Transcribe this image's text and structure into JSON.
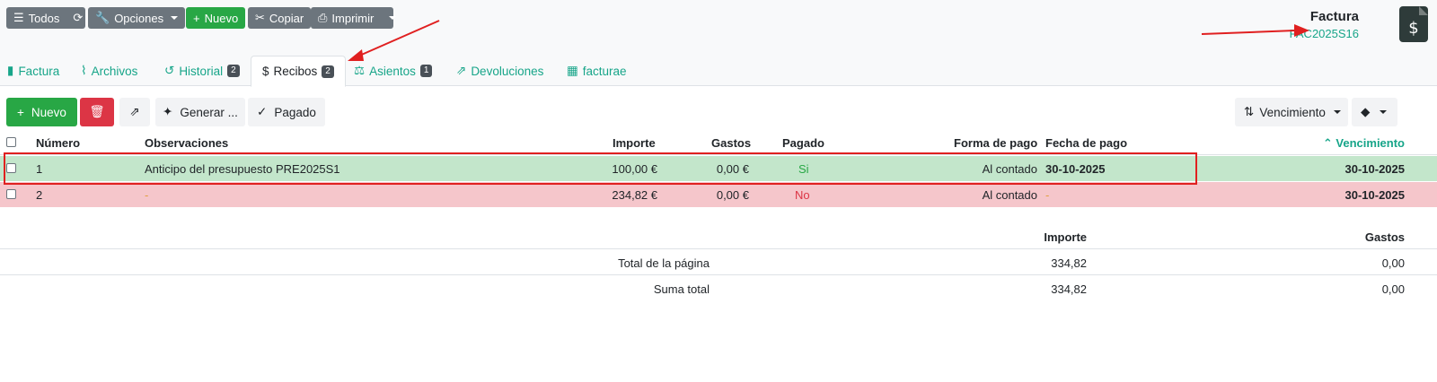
{
  "toolbar": {
    "todos": "Todos",
    "opciones": "Opciones",
    "nuevo": "Nuevo",
    "copiar": "Copiar",
    "imprimir": "Imprimir"
  },
  "document": {
    "title": "Factura",
    "code": "FAC2025S16"
  },
  "tabs": [
    {
      "label": "Factura",
      "icon": "file-icon"
    },
    {
      "label": "Archivos",
      "icon": "paperclip-icon"
    },
    {
      "label": "Historial",
      "icon": "history-icon",
      "badge": "2"
    },
    {
      "label": "Recibos",
      "icon": "dollar-icon",
      "badge": "2",
      "active": true
    },
    {
      "label": "Asientos",
      "icon": "balance-icon",
      "badge": "1"
    },
    {
      "label": "Devoluciones",
      "icon": "share-icon"
    },
    {
      "label": "facturae",
      "icon": "qr-icon"
    }
  ],
  "list_toolbar": {
    "nuevo": "Nuevo",
    "generar": "Generar ...",
    "pagado": "Pagado",
    "vencimiento": "Vencimiento"
  },
  "table": {
    "headers": {
      "numero": "Número",
      "observaciones": "Observaciones",
      "importe": "Importe",
      "gastos": "Gastos",
      "pagado": "Pagado",
      "forma": "Forma de pago",
      "fecha": "Fecha de pago",
      "vencimiento": "Vencimiento"
    },
    "rows": [
      {
        "numero": "1",
        "observaciones": "Anticipo del presupuesto PRE2025S1",
        "importe": "100,00 €",
        "gastos": "0,00 €",
        "pagado": "Si",
        "forma": "Al contado",
        "fecha": "30-10-2025",
        "vencimiento": "30-10-2025"
      },
      {
        "numero": "2",
        "observaciones": "-",
        "importe": "234,82 €",
        "gastos": "0,00 €",
        "pagado": "No",
        "forma": "Al contado",
        "fecha": "-",
        "vencimiento": "30-10-2025"
      }
    ]
  },
  "totals": {
    "h_importe": "Importe",
    "h_gastos": "Gastos",
    "page_label": "Total de la página",
    "page_importe": "334,82",
    "page_gastos": "0,00",
    "sum_label": "Suma total",
    "sum_importe": "334,82",
    "sum_gastos": "0,00"
  },
  "colors": {
    "accent": "#17a589",
    "paid_row": "#c3e6cb",
    "unpaid_row": "#f5c6cb",
    "annotation": "#e02020"
  }
}
